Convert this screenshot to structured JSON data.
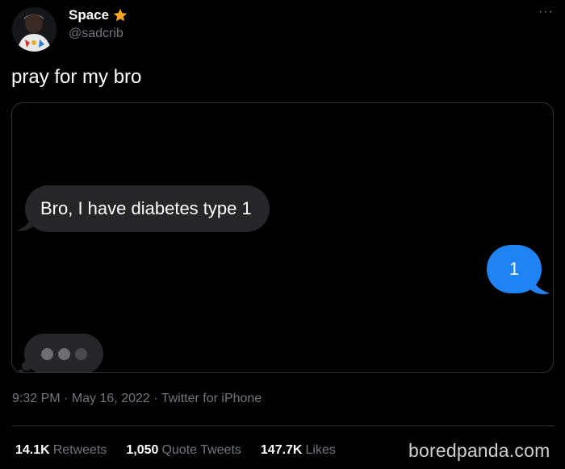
{
  "author": {
    "display_name": "Space",
    "badge_icon": "star-icon",
    "badge_color": "#f5a623",
    "handle": "@sadcrib"
  },
  "header": {
    "more_icon": "more-icon",
    "more_glyph": "···"
  },
  "tweet": {
    "text": "pray for my bro"
  },
  "conversation": {
    "received_message": "Bro, I have diabetes type 1",
    "sent_message": "1",
    "typing_indicator_dots": 3,
    "received_color": "#262629",
    "sent_color": "#1f83f3"
  },
  "meta": {
    "time": "9:32 PM",
    "separator": "·",
    "date": "May 16, 2022",
    "source": "Twitter for iPhone"
  },
  "stats": {
    "retweets_count": "14.1K",
    "retweets_label": "Retweets",
    "quotes_count": "1,050",
    "quotes_label": "Quote Tweets",
    "likes_count": "147.7K",
    "likes_label": "Likes"
  },
  "watermark": "boredpanda.com"
}
